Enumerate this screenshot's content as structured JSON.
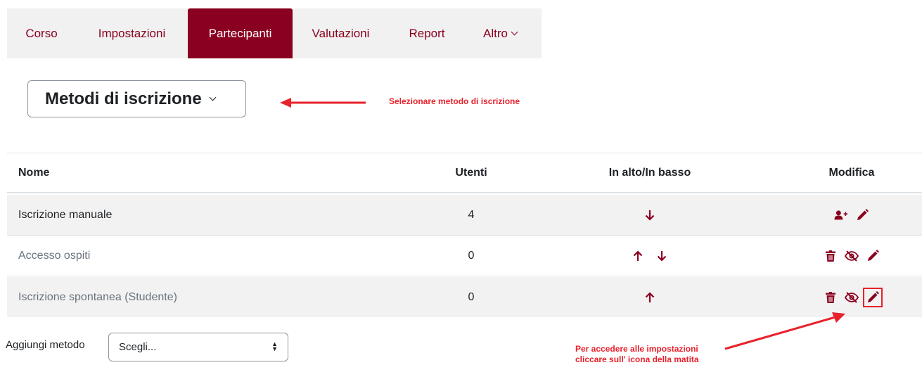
{
  "nav": {
    "tabs": [
      {
        "label": "Corso"
      },
      {
        "label": "Impostazioni"
      },
      {
        "label": "Partecipanti",
        "active": true
      },
      {
        "label": "Valutazioni"
      },
      {
        "label": "Report"
      },
      {
        "label": "Altro"
      }
    ]
  },
  "method_selector": {
    "label": "Metodi di iscrizione"
  },
  "annotations": {
    "select_method": "Selezionare metodo di iscrizione",
    "pencil_line1": "Per accedere alle impostazioni",
    "pencil_line2": "cliccare sull' icona della matita"
  },
  "table": {
    "headers": {
      "name": "Nome",
      "users": "Utenti",
      "move": "In alto/In basso",
      "edit": "Modifica"
    },
    "rows": [
      {
        "name": "Iscrizione manuale",
        "users": "4",
        "move": [
          "down"
        ],
        "edit": [
          "enrol-users-icon",
          "pencil-icon"
        ],
        "enabled": true
      },
      {
        "name": "Accesso ospiti",
        "users": "0",
        "move": [
          "up",
          "down"
        ],
        "edit": [
          "trash-icon",
          "eye-slash-icon",
          "pencil-icon"
        ],
        "enabled": false
      },
      {
        "name": "Iscrizione spontanea (Studente)",
        "users": "0",
        "move": [
          "up"
        ],
        "edit": [
          "trash-icon",
          "eye-slash-icon",
          "pencil-icon"
        ],
        "enabled": false
      }
    ]
  },
  "add_method": {
    "label": "Aggiungi metodo",
    "selected": "Scegli..."
  },
  "colors": {
    "brand": "#890020",
    "annotation": "#e8212b"
  }
}
